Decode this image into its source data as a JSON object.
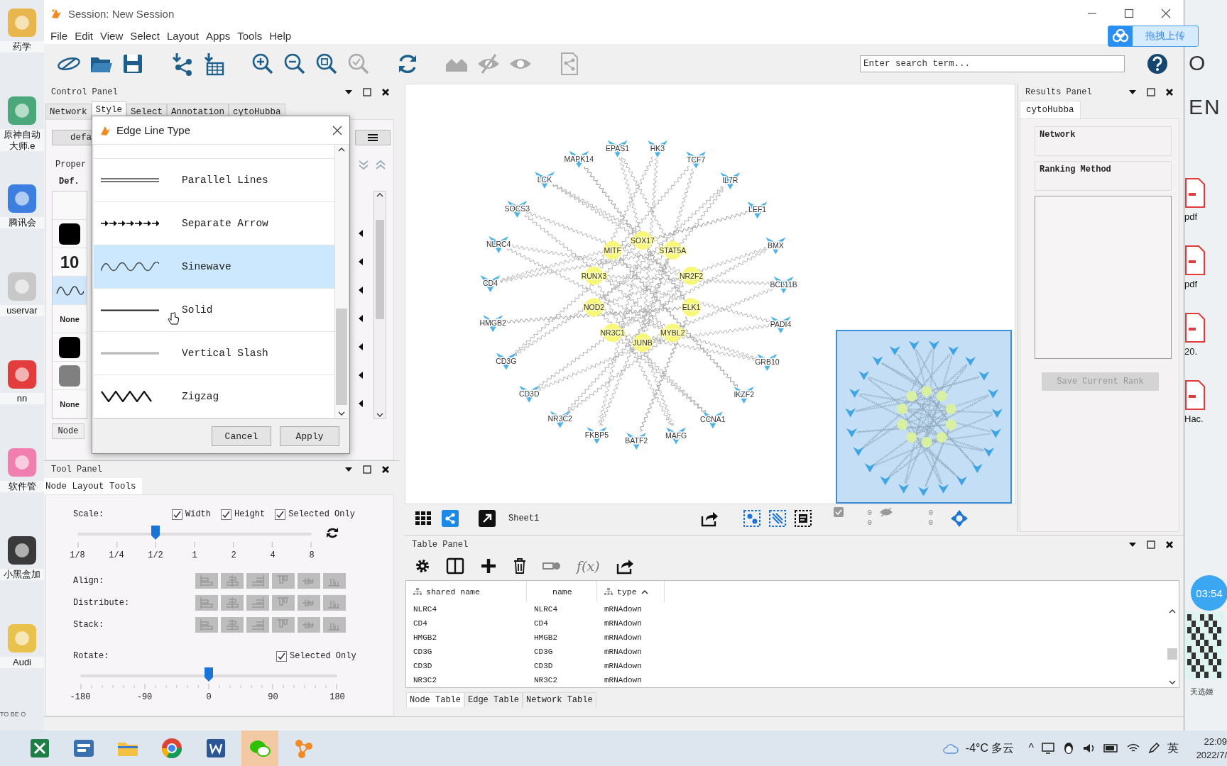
{
  "desktop": {
    "left_icons": [
      {
        "label": "药学"
      },
      {
        "label": "原神自动大师.e"
      },
      {
        "label": "腾讯会"
      },
      {
        "label": "uservar"
      },
      {
        "label": "nn"
      },
      {
        "label": "软件管"
      },
      {
        "label": "小黑盒加"
      },
      {
        "label": "Audi"
      }
    ],
    "left_caption": "TO BE O",
    "upload_button": "拖拽上传",
    "background_text": [
      "O",
      "EN"
    ],
    "right_files": [
      {
        "label": "pdf"
      },
      {
        "label": "pdf"
      },
      {
        "label": "20."
      },
      {
        "label": "Hac."
      }
    ],
    "timer": "03:54",
    "widget_label": "天选姬"
  },
  "window": {
    "title": "Session: New Session"
  },
  "menu": [
    "File",
    "Edit",
    "View",
    "Select",
    "Layout",
    "Apps",
    "Tools",
    "Help"
  ],
  "search": {
    "placeholder": "Enter search term..."
  },
  "control_panel": {
    "title": "Control Panel",
    "tabs": [
      {
        "label": "Network",
        "selected": false
      },
      {
        "label": "Style",
        "selected": true
      },
      {
        "label": "Select",
        "selected": false
      },
      {
        "label": "Annotation",
        "selected": false
      },
      {
        "label": "cytoHubba",
        "selected": false
      }
    ],
    "style_button": "defa",
    "properties_label": "Proper",
    "def_label": "Def.",
    "properties": [
      {
        "kind": "empty",
        "selected": false
      },
      {
        "kind": "color",
        "color": "#000000",
        "selected": false
      },
      {
        "kind": "text",
        "value": "10",
        "selected": false
      },
      {
        "kind": "line",
        "selected": true
      },
      {
        "kind": "text",
        "value": "None",
        "selected": false
      },
      {
        "kind": "color",
        "color": "#000000",
        "selected": false
      },
      {
        "kind": "color",
        "color": "#808080",
        "selected": false
      },
      {
        "kind": "text",
        "value": "None",
        "selected": false
      }
    ],
    "bottom_tab": "Node"
  },
  "dialog": {
    "title": "Edge Line Type",
    "options": [
      {
        "label": "Parallel Lines",
        "kind": "parallel",
        "selected": false
      },
      {
        "label": "Separate Arrow",
        "kind": "arrows",
        "selected": false
      },
      {
        "label": "Sinewave",
        "kind": "sine",
        "selected": true
      },
      {
        "label": "Solid",
        "kind": "solid",
        "selected": false
      },
      {
        "label": "Vertical Slash",
        "kind": "slash",
        "selected": false
      },
      {
        "label": "Zigzag",
        "kind": "zigzag",
        "selected": false
      }
    ],
    "buttons": [
      "Cancel",
      "Apply"
    ]
  },
  "tool_panel": {
    "title": "Tool Panel",
    "tab": "Node Layout Tools",
    "scale_label": "Scale:",
    "scale_checks": [
      {
        "label": "Width",
        "checked": true
      },
      {
        "label": "Height",
        "checked": true
      },
      {
        "label": "Selected Only",
        "checked": true
      }
    ],
    "scale_slider": {
      "level": 0.333,
      "ticks": [
        "1/8",
        "1/4",
        "1/2",
        "1",
        "2",
        "4",
        "8"
      ]
    },
    "button_rows": [
      {
        "label": "Align:",
        "disabled": true
      },
      {
        "label": "Distribute:",
        "disabled": true
      },
      {
        "label": "Stack:",
        "disabled": true
      }
    ],
    "rotate_label": "Rotate:",
    "rotate_check": {
      "label": "Selected Only",
      "checked": true
    },
    "rotate_slider": {
      "level": 0.5,
      "ticks": [
        "-180",
        "-90",
        "0",
        "90",
        "180"
      ]
    }
  },
  "network": {
    "nodes": [
      {
        "label": "SOX17",
        "kind": "ellipse"
      },
      {
        "label": "MITF",
        "kind": "ellipse"
      },
      {
        "label": "STAT5A",
        "kind": "ellipse"
      },
      {
        "label": "RUNX3",
        "kind": "ellipse"
      },
      {
        "label": "NR2F2",
        "kind": "ellipse"
      },
      {
        "label": "NOD2",
        "kind": "ellipse"
      },
      {
        "label": "ELK1",
        "kind": "ellipse"
      },
      {
        "label": "NR3C1",
        "kind": "ellipse"
      },
      {
        "label": "MYBL2",
        "kind": "ellipse"
      },
      {
        "label": "JUNB",
        "kind": "ellipse"
      },
      {
        "label": "EPAS1",
        "kind": "v"
      },
      {
        "label": "HK3",
        "kind": "v"
      },
      {
        "label": "MAPK14",
        "kind": "v"
      },
      {
        "label": "TCF7",
        "kind": "v"
      },
      {
        "label": "LCK",
        "kind": "v"
      },
      {
        "label": "IL7R",
        "kind": "v"
      },
      {
        "label": "SOCS3",
        "kind": "v"
      },
      {
        "label": "LEF1",
        "kind": "v"
      },
      {
        "label": "NLRC4",
        "kind": "v"
      },
      {
        "label": "BMX",
        "kind": "v"
      },
      {
        "label": "CD4",
        "kind": "v"
      },
      {
        "label": "BCL11B",
        "kind": "v"
      },
      {
        "label": "HMGB2",
        "kind": "v"
      },
      {
        "label": "PADI4",
        "kind": "v"
      },
      {
        "label": "CD3G",
        "kind": "v"
      },
      {
        "label": "GRB10",
        "kind": "v"
      },
      {
        "label": "CD3D",
        "kind": "v"
      },
      {
        "label": "IKZF2",
        "kind": "v"
      },
      {
        "label": "NR3C2",
        "kind": "v"
      },
      {
        "label": "CCNA1",
        "kind": "v"
      },
      {
        "label": "FKBP5",
        "kind": "v"
      },
      {
        "label": "MAFG",
        "kind": "v"
      },
      {
        "label": "BATF2",
        "kind": "v"
      }
    ],
    "sheet": "Sheet1",
    "counts": [
      "0",
      "0",
      "0",
      "0"
    ]
  },
  "results_panel": {
    "title": "Results Panel",
    "tab": "cytoHubba",
    "network_label": "Network",
    "ranking_label": "Ranking Method",
    "save_button": {
      "label": "Save Current Rank",
      "disabled": true
    }
  },
  "table_panel": {
    "title": "Table Panel",
    "function_button": "f(x)",
    "columns": [
      "shared name",
      "name",
      "type"
    ],
    "rows": [
      [
        "NLRC4",
        "NLRC4",
        "mRNAdown"
      ],
      [
        "CD4",
        "CD4",
        "mRNAdown"
      ],
      [
        "HMGB2",
        "HMGB2",
        "mRNAdown"
      ],
      [
        "CD3G",
        "CD3G",
        "mRNAdown"
      ],
      [
        "CD3D",
        "CD3D",
        "mRNAdown"
      ],
      [
        "NR3C2",
        "NR3C2",
        "mRNAdown"
      ]
    ],
    "tabs": [
      {
        "label": "Node Table",
        "selected": true
      },
      {
        "label": "Edge Table",
        "selected": false
      },
      {
        "label": "Network Table",
        "selected": false
      }
    ]
  },
  "taskbar": {
    "weather": "-4°C 多云",
    "tray_caret": "^",
    "ime": "英",
    "time": "22:09",
    "date": "2022/7/"
  }
}
